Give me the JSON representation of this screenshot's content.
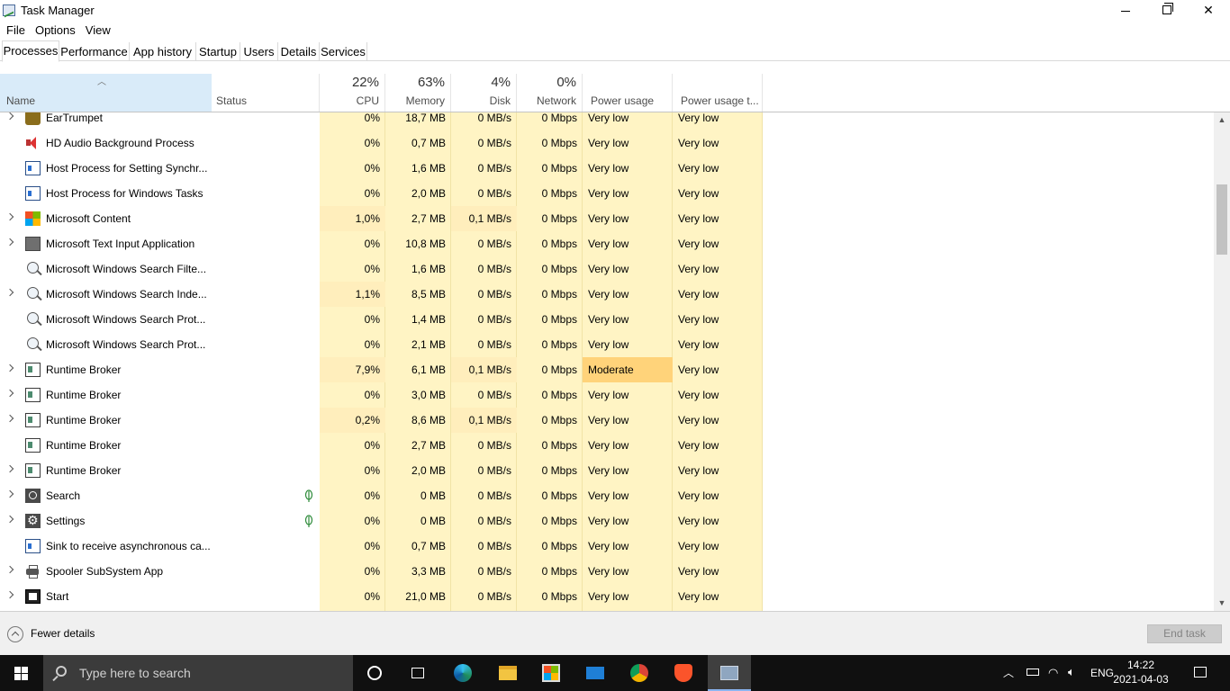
{
  "window": {
    "title": "Task Manager"
  },
  "menu": [
    "File",
    "Options",
    "View"
  ],
  "tabs": [
    "Processes",
    "Performance",
    "App history",
    "Startup",
    "Users",
    "Details",
    "Services"
  ],
  "header": {
    "name": "Name",
    "status": "Status",
    "cpu": {
      "pct": "22%",
      "label": "CPU"
    },
    "memory": {
      "pct": "63%",
      "label": "Memory"
    },
    "disk": {
      "pct": "4%",
      "label": "Disk"
    },
    "network": {
      "pct": "0%",
      "label": "Network"
    },
    "power": "Power usage",
    "power_trend": "Power usage t..."
  },
  "rows": [
    {
      "name": "EarTrumpet",
      "icon": "eartrumpet-icon",
      "cpu": "0%",
      "mem": "18,7 MB",
      "disk": "0 MB/s",
      "net": "0 Mbps",
      "power": "Very low",
      "trend": "Very low"
    },
    {
      "name": "HD Audio Background Process",
      "icon": "speaker-icon",
      "cpu": "0%",
      "mem": "0,7 MB",
      "disk": "0 MB/s",
      "net": "0 Mbps",
      "power": "Very low",
      "trend": "Very low"
    },
    {
      "name": "Host Process for Setting Synchr...",
      "icon": "app-window-icon",
      "cpu": "0%",
      "mem": "1,6 MB",
      "disk": "0 MB/s",
      "net": "0 Mbps",
      "power": "Very low",
      "trend": "Very low"
    },
    {
      "name": "Host Process for Windows Tasks",
      "icon": "app-window-icon",
      "cpu": "0%",
      "mem": "2,0 MB",
      "disk": "0 MB/s",
      "net": "0 Mbps",
      "power": "Very low",
      "trend": "Very low"
    },
    {
      "name": "Microsoft Content",
      "icon": "microsoft-logo-icon",
      "cpu": "1,0%",
      "mem": "2,7 MB",
      "disk": "0,1 MB/s",
      "net": "0 Mbps",
      "power": "Very low",
      "trend": "Very low"
    },
    {
      "name": "Microsoft Text Input Application",
      "icon": "keyboard-icon",
      "cpu": "0%",
      "mem": "10,8 MB",
      "disk": "0 MB/s",
      "net": "0 Mbps",
      "power": "Very low",
      "trend": "Very low"
    },
    {
      "name": "Microsoft Windows Search Filte...",
      "icon": "search-process-icon",
      "cpu": "0%",
      "mem": "1,6 MB",
      "disk": "0 MB/s",
      "net": "0 Mbps",
      "power": "Very low",
      "trend": "Very low"
    },
    {
      "name": "Microsoft Windows Search Inde...",
      "icon": "search-process-icon",
      "cpu": "1,1%",
      "mem": "8,5 MB",
      "disk": "0 MB/s",
      "net": "0 Mbps",
      "power": "Very low",
      "trend": "Very low"
    },
    {
      "name": "Microsoft Windows Search Prot...",
      "icon": "search-process-icon",
      "cpu": "0%",
      "mem": "1,4 MB",
      "disk": "0 MB/s",
      "net": "0 Mbps",
      "power": "Very low",
      "trend": "Very low"
    },
    {
      "name": "Microsoft Windows Search Prot...",
      "icon": "search-process-icon",
      "cpu": "0%",
      "mem": "2,1 MB",
      "disk": "0 MB/s",
      "net": "0 Mbps",
      "power": "Very low",
      "trend": "Very low"
    },
    {
      "name": "Runtime Broker",
      "icon": "runtime-broker-icon",
      "cpu": "7,9%",
      "mem": "6,1 MB",
      "disk": "0,1 MB/s",
      "net": "0 Mbps",
      "power": "Moderate",
      "trend": "Very low"
    },
    {
      "name": "Runtime Broker",
      "icon": "runtime-broker-icon",
      "cpu": "0%",
      "mem": "3,0 MB",
      "disk": "0 MB/s",
      "net": "0 Mbps",
      "power": "Very low",
      "trend": "Very low"
    },
    {
      "name": "Runtime Broker",
      "icon": "runtime-broker-icon",
      "cpu": "0,2%",
      "mem": "8,6 MB",
      "disk": "0,1 MB/s",
      "net": "0 Mbps",
      "power": "Very low",
      "trend": "Very low"
    },
    {
      "name": "Runtime Broker",
      "icon": "runtime-broker-icon",
      "cpu": "0%",
      "mem": "2,7 MB",
      "disk": "0 MB/s",
      "net": "0 Mbps",
      "power": "Very low",
      "trend": "Very low"
    },
    {
      "name": "Runtime Broker",
      "icon": "runtime-broker-icon",
      "cpu": "0%",
      "mem": "2,0 MB",
      "disk": "0 MB/s",
      "net": "0 Mbps",
      "power": "Very low",
      "trend": "Very low"
    },
    {
      "name": "Search",
      "icon": "search-icon",
      "cpu": "0%",
      "mem": "0 MB",
      "disk": "0 MB/s",
      "net": "0 Mbps",
      "power": "Very low",
      "trend": "Very low"
    },
    {
      "name": "Settings",
      "icon": "settings-gear-icon",
      "cpu": "0%",
      "mem": "0 MB",
      "disk": "0 MB/s",
      "net": "0 Mbps",
      "power": "Very low",
      "trend": "Very low"
    },
    {
      "name": "Sink to receive asynchronous ca...",
      "icon": "app-window-icon",
      "cpu": "0%",
      "mem": "0,7 MB",
      "disk": "0 MB/s",
      "net": "0 Mbps",
      "power": "Very low",
      "trend": "Very low"
    },
    {
      "name": "Spooler SubSystem App",
      "icon": "printer-icon",
      "cpu": "0%",
      "mem": "3,3 MB",
      "disk": "0 MB/s",
      "net": "0 Mbps",
      "power": "Very low",
      "trend": "Very low"
    },
    {
      "name": "Start",
      "icon": "start-icon",
      "cpu": "0%",
      "mem": "21,0 MB",
      "disk": "0 MB/s",
      "net": "0 Mbps",
      "power": "Very low",
      "trend": "Very low"
    }
  ],
  "footer": {
    "fewer_details": "Fewer details",
    "end_task": "End task"
  },
  "taskbar": {
    "search_placeholder": "Type here to search",
    "language": "ENG",
    "time": "14:22",
    "date": "2021-04-03"
  },
  "colors": {
    "accent": "#0078d7",
    "cell_bg": "#fff4c4",
    "moderate": "#ffd37a",
    "header_sorted": "#d9ebf9"
  }
}
